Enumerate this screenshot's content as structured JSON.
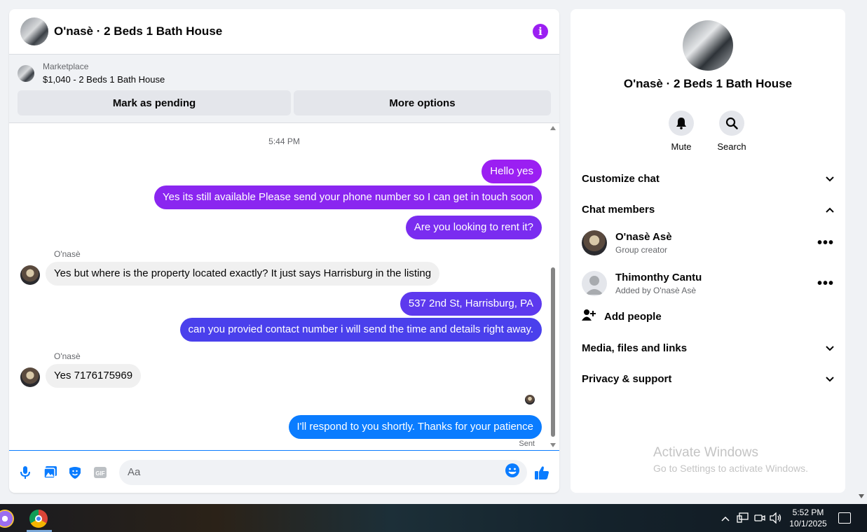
{
  "chat": {
    "title": "O'nasè · 2 Beds 1 Bath House",
    "listing": {
      "category": "Marketplace",
      "price_title": "$1,040 - 2 Beds 1 Bath House",
      "mark_pending": "Mark as pending",
      "more_options": "More options"
    },
    "timestamp": "5:44 PM",
    "messages": [
      {
        "from": "me",
        "text": "Hello yes"
      },
      {
        "from": "me",
        "text": "Yes its still available Please send your phone number so I can get in touch soon"
      },
      {
        "from": "me",
        "text": "Are you looking to rent it?"
      },
      {
        "from": "them",
        "sender": "O'nasè",
        "text": "Yes but where is the property located exactly? It just says Harrisburg in the listing"
      },
      {
        "from": "me",
        "text": "537 2nd St, Harrisburg, PA"
      },
      {
        "from": "me",
        "text": "can you provied contact number i will send the time and details right away."
      },
      {
        "from": "them",
        "sender": "O'nasè",
        "text": "Yes 7176175969"
      },
      {
        "from": "me",
        "text": "I'll respond to you shortly. Thanks for your patience"
      }
    ],
    "sent_status": "Sent",
    "composer_placeholder": "Aa",
    "colors": {
      "out_bubbles": [
        "#9b1ff2",
        "#8a26f0",
        "#7a2cf0",
        "#5d39ee",
        "#4a40ec",
        "#3e44ec",
        "#0a7cff"
      ],
      "accent": "#9b1ff2"
    }
  },
  "sidebar": {
    "title": "O'nasè · 2 Beds 1 Bath House",
    "actions": [
      {
        "label": "Mute",
        "icon": "bell-icon"
      },
      {
        "label": "Search",
        "icon": "search-icon"
      }
    ],
    "sections": {
      "customize": "Customize chat",
      "members": "Chat members",
      "media": "Media, files and links",
      "privacy": "Privacy & support"
    },
    "members": [
      {
        "name": "O'nasè Asè",
        "role": "Group creator"
      },
      {
        "name": "Thimonthy Cantu",
        "role": "Added by O'nasè Asè"
      }
    ],
    "add_people": "Add people",
    "watermark": {
      "line1": "Activate Windows",
      "line2": "Go to Settings to activate Windows."
    }
  },
  "taskbar": {
    "time": "5:52 PM",
    "date": "10/1/2025"
  }
}
